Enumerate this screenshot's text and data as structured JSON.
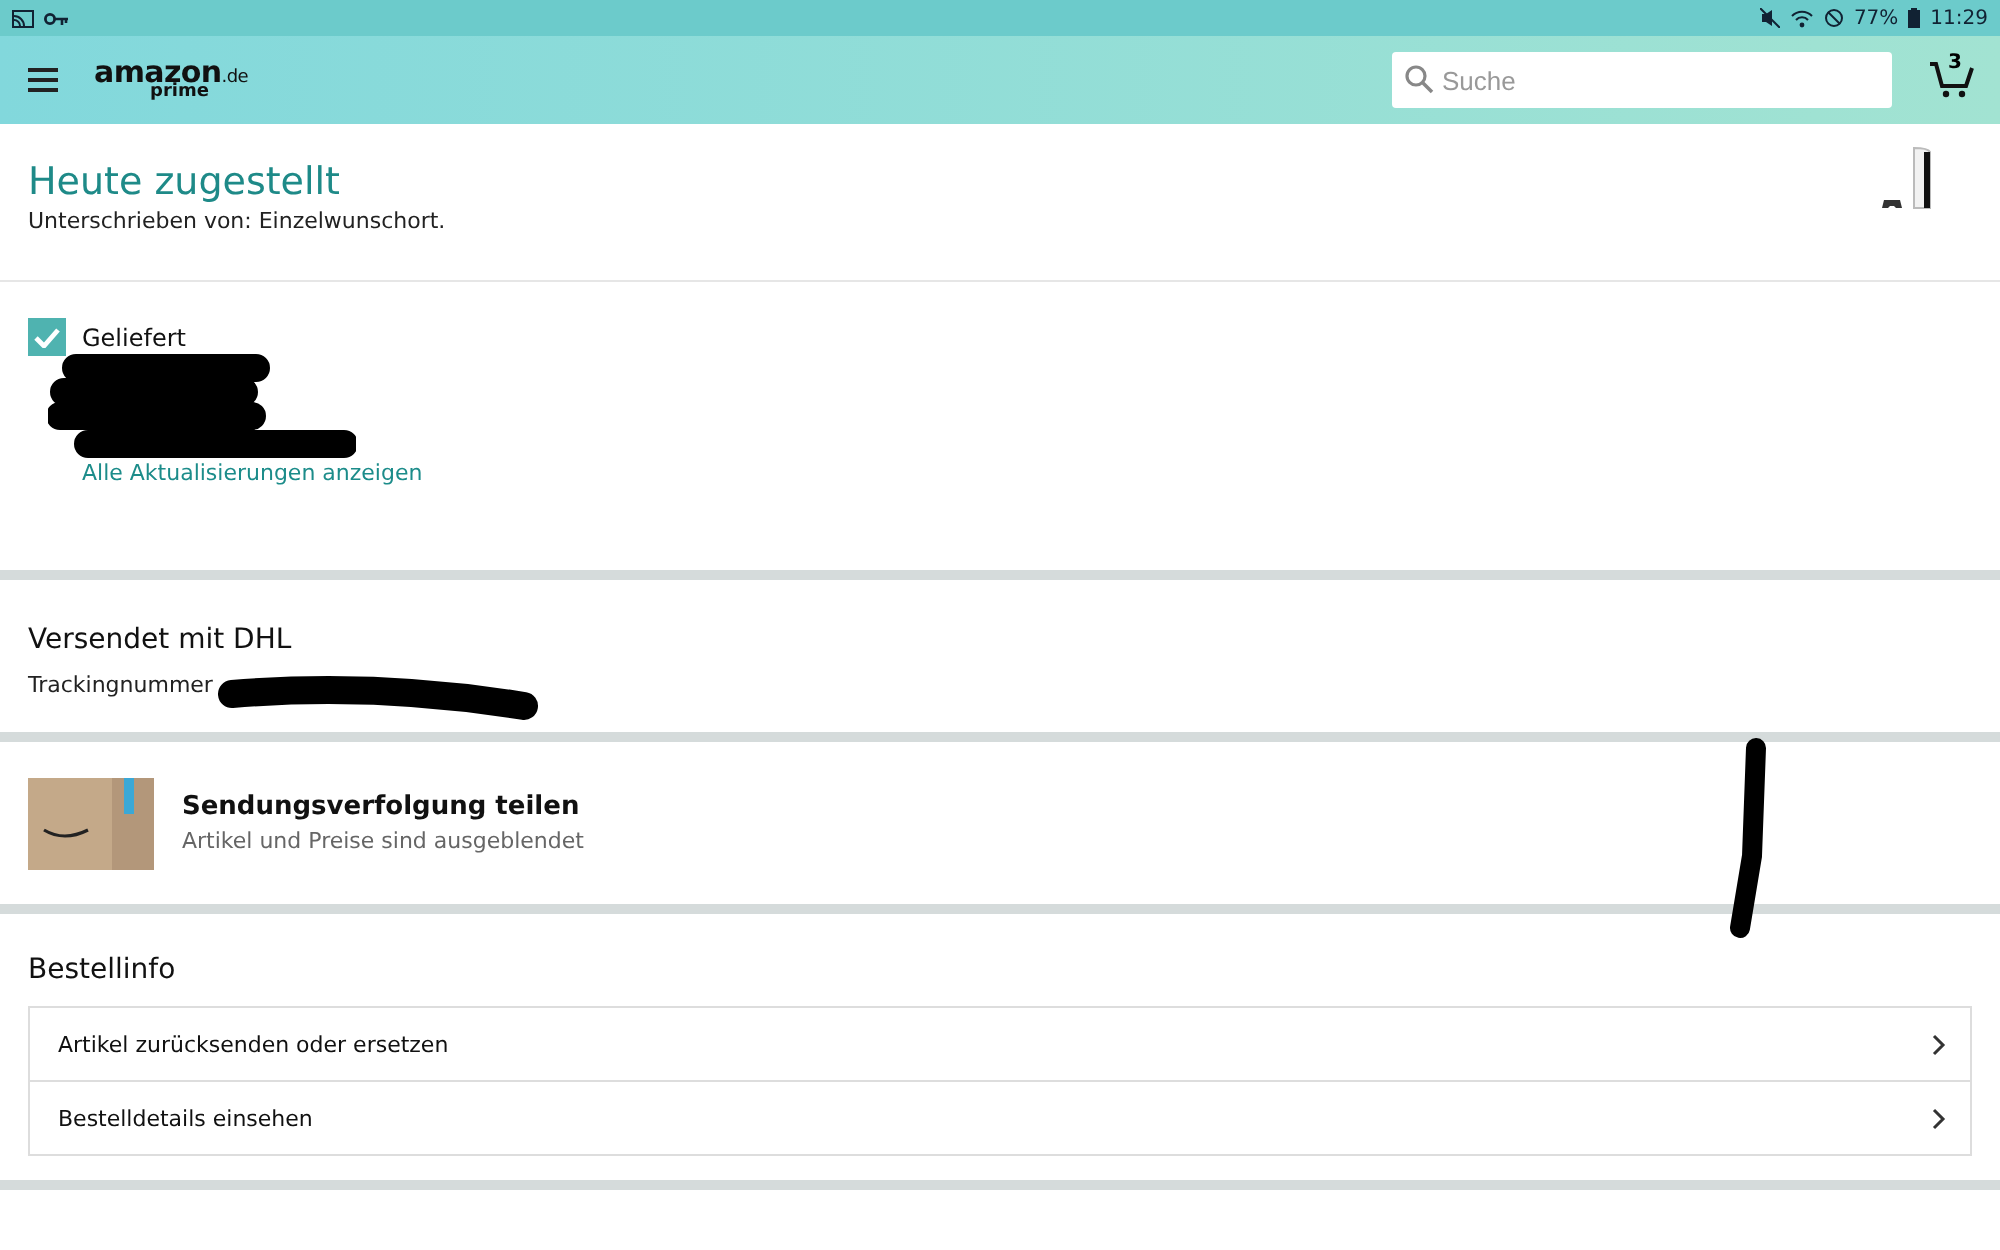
{
  "status_bar": {
    "battery": "77%",
    "time": "11:29"
  },
  "header": {
    "logo": {
      "wordmark": "amazon",
      "domain": ".de",
      "tier": "prime"
    },
    "search": {
      "placeholder": "Suche"
    },
    "cart_count": "3"
  },
  "delivery": {
    "title": "Heute zugestellt",
    "signed_by": "Unterschrieben von: Einzelwunschort."
  },
  "progress": {
    "status": {
      "label": "Geliefert",
      "checked": true
    },
    "link": "Alle Aktualisierungen anzeigen"
  },
  "shipping": {
    "title": "Versendet mit DHL",
    "tracking_label": "Trackingnummer"
  },
  "share": {
    "title": "Sendungsverfolgung teilen",
    "subtitle": "Artikel und Preise sind ausgeblendet"
  },
  "order_info": {
    "title": "Bestellinfo",
    "items": [
      {
        "label": "Artikel zurücksenden oder ersetzen"
      },
      {
        "label": "Bestelldetails einsehen"
      }
    ]
  }
}
